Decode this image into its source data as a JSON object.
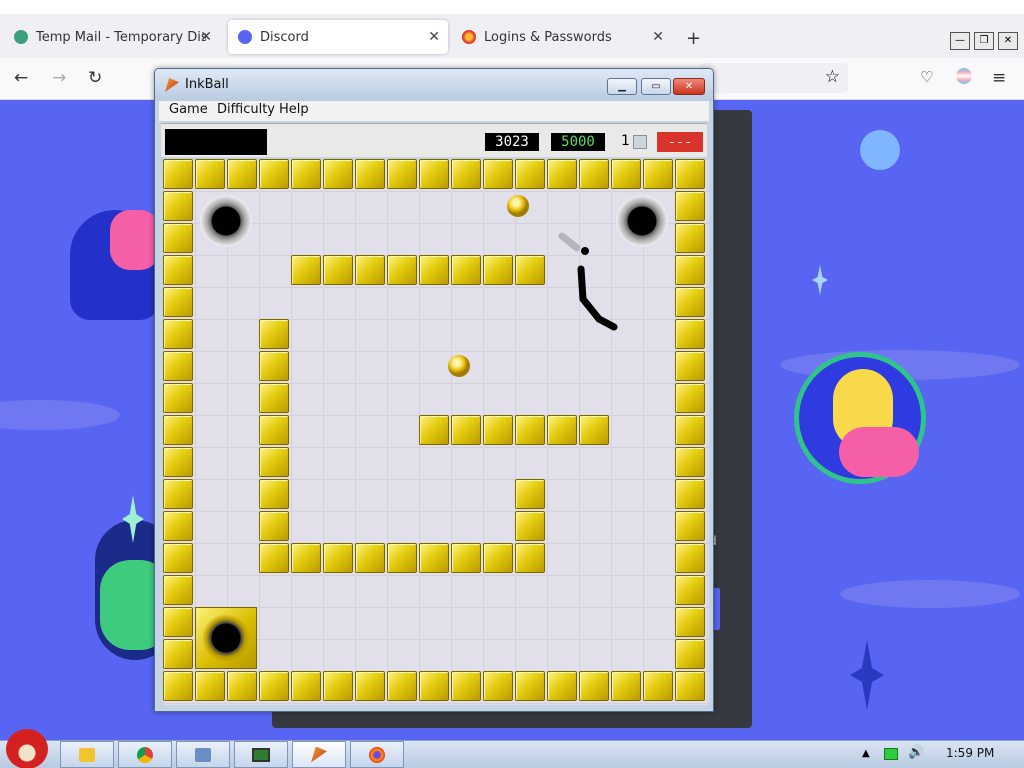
{
  "browser": {
    "tabs": [
      {
        "label": "Temp Mail - Temporary Dispo",
        "icon": "tempmail-icon"
      },
      {
        "label": "Discord",
        "icon": "discord-icon",
        "active": true
      },
      {
        "label": "Logins & Passwords",
        "icon": "firefox-icon"
      }
    ],
    "new_tab": "+",
    "nav": {
      "back": "←",
      "forward": "→",
      "reload": "↻",
      "star": "☆",
      "pocket": "♡",
      "menu": "≡"
    }
  },
  "page": {
    "fragment_text": "d"
  },
  "inkball": {
    "title": "InkBall",
    "menu": [
      "Game",
      "Difficulty",
      "Help"
    ],
    "score": "3023",
    "target": "5000",
    "balls_left": "1",
    "queue": "- - -",
    "colors": {
      "brick": "#e5cc10",
      "score_text": "#ffffff",
      "target_text": "#5fdc5f",
      "queue_bg": "#d9342b"
    }
  },
  "taskbar": {
    "clock": "1:59 PM"
  }
}
